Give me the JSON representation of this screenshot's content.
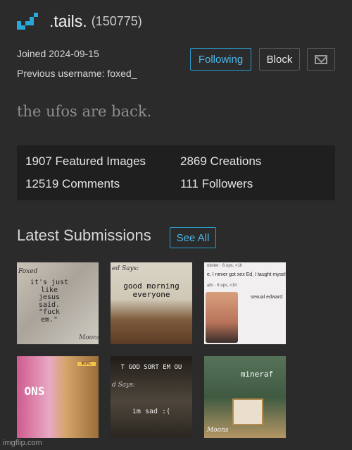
{
  "profile": {
    "username": ".tails.",
    "points": "(150775)",
    "joined": "Joined 2024-09-15",
    "previous_username": "Previous username: foxed_",
    "bio": "the ufos are back."
  },
  "actions": {
    "following_label": "Following",
    "block_label": "Block",
    "message_icon": "envelope-icon"
  },
  "stats": {
    "featured": "1907 Featured Images",
    "creations": "2869 Creations",
    "comments": "12519 Comments",
    "followers": "111 Followers"
  },
  "submissions": {
    "heading": "Latest Submissions",
    "see_all_label": "See All",
    "items": [
      {
        "caption": "it's just like jesus said. \"fuck em.\"",
        "tag": "Foxed",
        "mark": "Moons"
      },
      {
        "caption": "good morning everyone",
        "tag": "ed Says:"
      },
      {
        "line1": "ubster · 6 ups, <1h",
        "line2": "e, I never got sex Ed, I taught mysel",
        "line3": "ails · 6 ups, <1h",
        "reply": "sexual edward"
      },
      {
        "caption": "ONS",
        "tag": "ФОКС"
      },
      {
        "caption": "im sad :(",
        "top_text": "T GOD SORT EM OU",
        "tag": "d Says:"
      },
      {
        "caption": "mineraf",
        "mark": "Moons"
      }
    ]
  },
  "footer": {
    "watermark": "imgflip.com"
  },
  "colors": {
    "background": "#2b2b2b",
    "accent": "#2aa6d8",
    "panel": "#1f1f1f"
  }
}
